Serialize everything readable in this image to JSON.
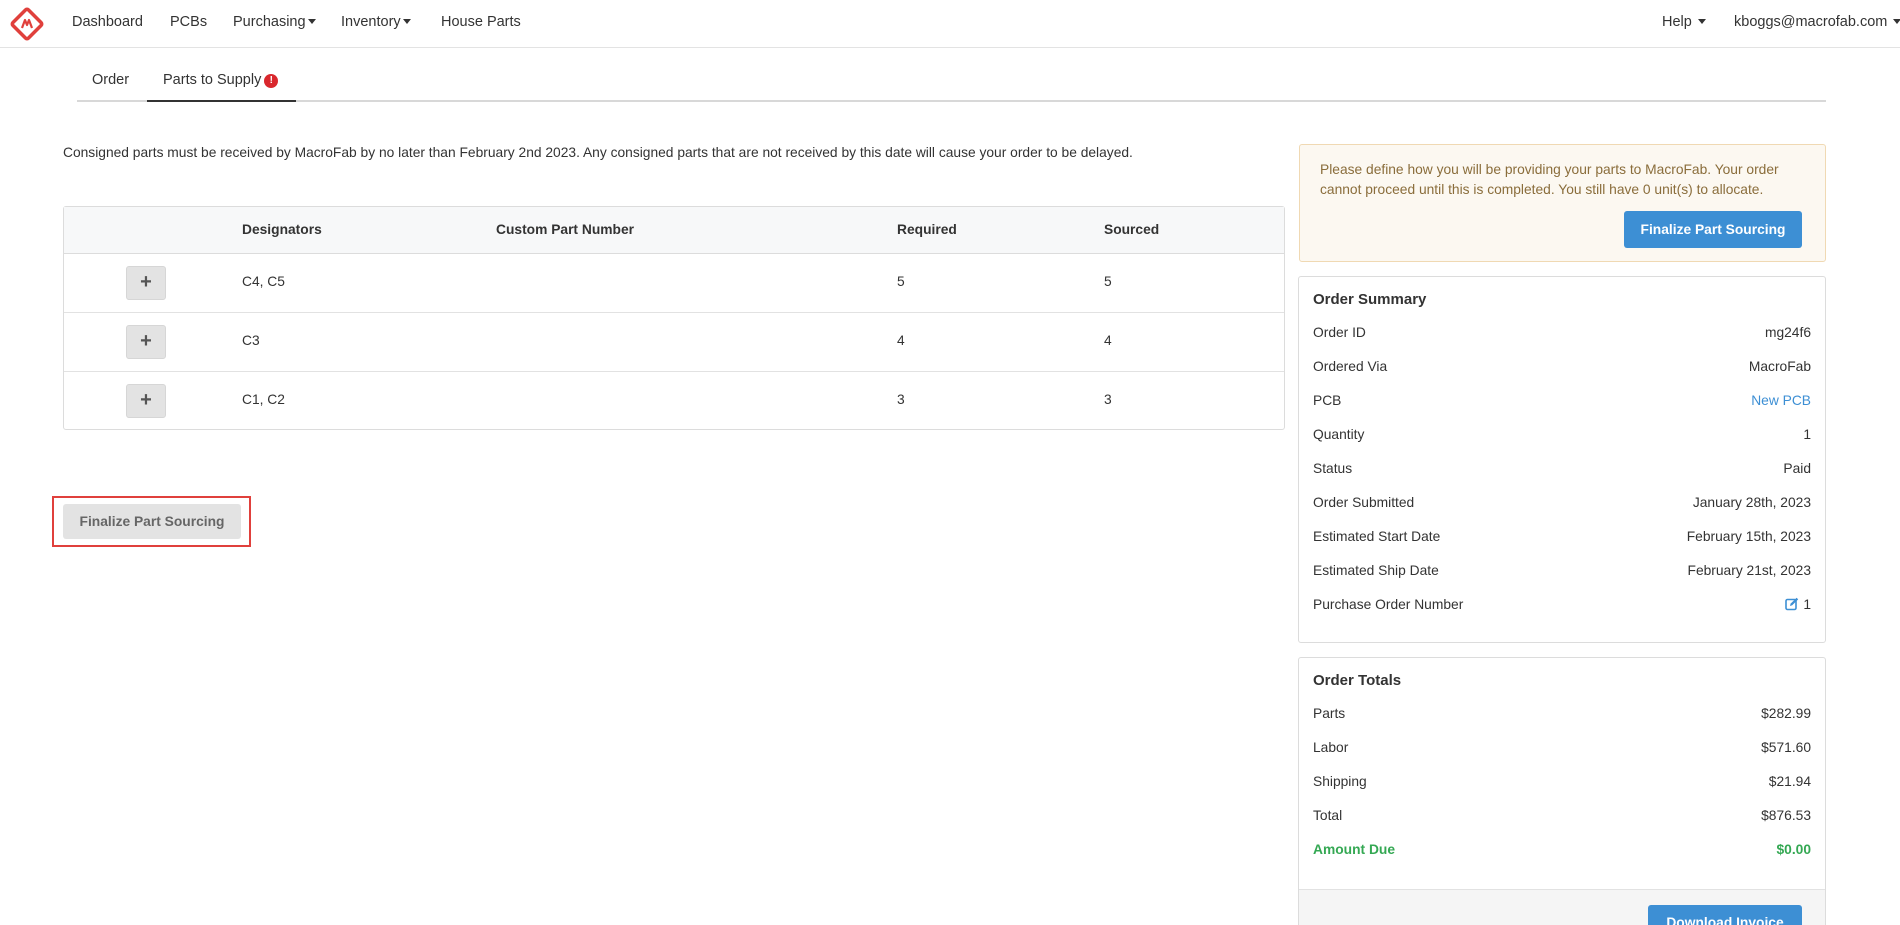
{
  "colors": {
    "brand": "#e0403c",
    "primary": "#3d8fd4",
    "alert": "#d9282d",
    "success": "#34a853",
    "warning_text": "#8a6d3b"
  },
  "nav": {
    "logo_icon": "macrofab-logo-icon",
    "items": [
      "Dashboard",
      "PCBs",
      "Purchasing",
      "Inventory",
      "House Parts"
    ],
    "help": "Help",
    "user": "kboggs@macrofab.com"
  },
  "tabs": {
    "order": "Order",
    "parts_to_supply": "Parts to Supply",
    "alert_badge": "!"
  },
  "notice": "Consigned parts must be received by MacroFab by no later than February 2nd 2023.  Any consigned parts that are not received by this date will cause your order to be delayed.",
  "parts_table": {
    "columns": [
      "Designators",
      "Custom Part Number",
      "Required",
      "Sourced"
    ],
    "expand_label": "+",
    "rows": [
      {
        "designators": "C4, C5",
        "custom_part_number": "",
        "required": "5",
        "sourced": "5"
      },
      {
        "designators": "C3",
        "custom_part_number": "",
        "required": "4",
        "sourced": "4"
      },
      {
        "designators": "C1, C2",
        "custom_part_number": "",
        "required": "3",
        "sourced": "3"
      }
    ]
  },
  "finalize_label": "Finalize Part Sourcing",
  "warning": {
    "text": "Please define how you will be providing your parts to MacroFab. Your order cannot proceed until this is completed. You still have 0 unit(s) to allocate.",
    "button": "Finalize Part Sourcing"
  },
  "order_summary": {
    "title": "Order Summary",
    "rows": [
      {
        "label": "Order ID",
        "value": "mg24f6"
      },
      {
        "label": "Ordered Via",
        "value": "MacroFab"
      },
      {
        "label": "PCB",
        "value": "New PCB"
      },
      {
        "label": "Quantity",
        "value": "1"
      },
      {
        "label": "Status",
        "value": "Paid"
      },
      {
        "label": "Order Submitted",
        "value": "January 28th, 2023"
      },
      {
        "label": "Estimated Start Date",
        "value": "February 15th, 2023"
      },
      {
        "label": "Estimated Ship Date",
        "value": "February 21st, 2023"
      },
      {
        "label": "Purchase Order Number",
        "value": "1"
      }
    ]
  },
  "order_totals": {
    "title": "Order Totals",
    "rows": [
      {
        "label": "Parts",
        "value": "$282.99"
      },
      {
        "label": "Labor",
        "value": "$571.60"
      },
      {
        "label": "Shipping",
        "value": "$21.94"
      },
      {
        "label": "Total",
        "value": "$876.53"
      },
      {
        "label": "Amount Due",
        "value": "$0.00"
      }
    ],
    "download_button": "Download Invoice"
  }
}
